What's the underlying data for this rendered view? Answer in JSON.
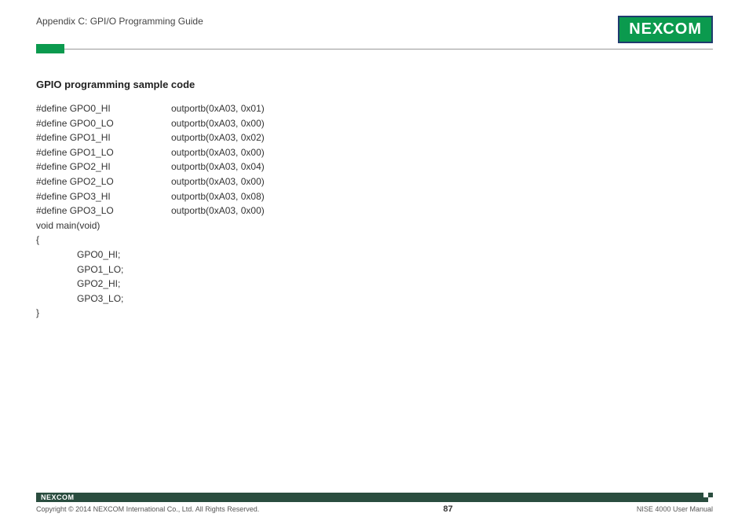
{
  "header": {
    "appendix": "Appendix C: GPI/O Programming Guide",
    "logo_pre": "NE",
    "logo_x": "X",
    "logo_post": "COM"
  },
  "section": {
    "title": "GPIO programming sample code"
  },
  "code": {
    "defines": [
      {
        "name": "#define GPO0_HI",
        "value": "outportb(0xA03, 0x01)"
      },
      {
        "name": "#define GPO0_LO",
        "value": "outportb(0xA03, 0x00)"
      },
      {
        "name": "#define GPO1_HI",
        "value": "outportb(0xA03, 0x02)"
      },
      {
        "name": "#define GPO1_LO",
        "value": "outportb(0xA03, 0x00)"
      },
      {
        "name": "#define GPO2_HI",
        "value": "outportb(0xA03, 0x04)"
      },
      {
        "name": "#define GPO2_LO",
        "value": "outportb(0xA03, 0x00)"
      },
      {
        "name": "#define GPO3_HI",
        "value": "outportb(0xA03, 0x08)"
      },
      {
        "name": "#define GPO3_LO",
        "value": "outportb(0xA03, 0x00)"
      }
    ],
    "main_sig": "void main(void)",
    "brace_open": "{",
    "body": [
      "GPO0_HI;",
      "GPO1_LO;",
      "GPO2_HI;",
      "GPO3_LO;"
    ],
    "brace_close": "}"
  },
  "footer": {
    "logo_pre": "NE",
    "logo_x": "X",
    "logo_post": "COM",
    "copyright": "Copyright © 2014 NEXCOM International Co., Ltd. All Rights Reserved.",
    "page": "87",
    "manual": "NISE 4000 User Manual"
  }
}
